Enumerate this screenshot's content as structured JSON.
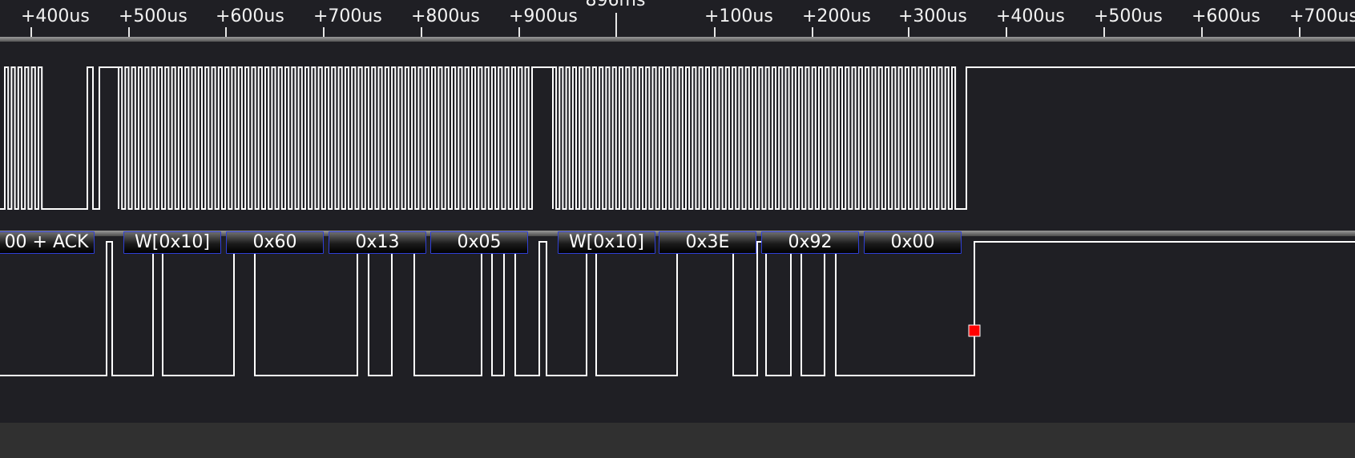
{
  "timeline": {
    "center_label": "896ms",
    "ticks": [
      "+400us",
      "+500us",
      "+600us",
      "+700us",
      "+800us",
      "+900us",
      "+100us",
      "+200us",
      "+300us",
      "+400us",
      "+500us",
      "+600us",
      "+700us"
    ]
  },
  "decoder": {
    "packets": [
      "00 + ACK",
      "W[0x10]",
      "0x60",
      "0x13",
      "0x05",
      "W[0x10]",
      "0x3E",
      "0x92",
      "0x00"
    ]
  },
  "colors": {
    "background": "#1f1f24",
    "waveform": "#ffffff",
    "packet_border": "#2f3fd6",
    "marker": "#ff0000"
  }
}
